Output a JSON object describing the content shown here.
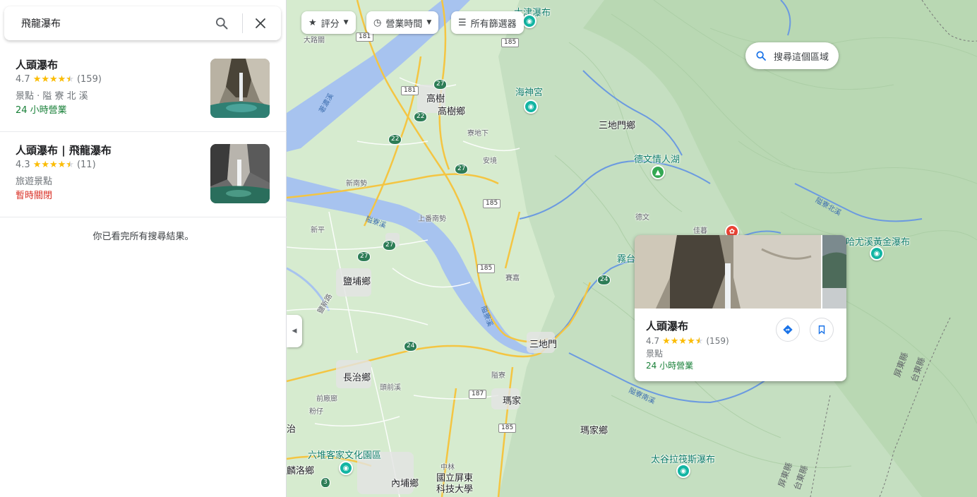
{
  "search": {
    "value": "飛龍瀑布"
  },
  "results": [
    {
      "title": "人頭瀑布",
      "rating": "4.7",
      "rating_value": 4.7,
      "reviews": "(159)",
      "category": "景點 · 隘 寮 北 溪",
      "status": "24 小時營業",
      "status_type": "open"
    },
    {
      "title": "人頭瀑布 | 飛龍瀑布",
      "rating": "4.3",
      "rating_value": 4.3,
      "reviews": "(11)",
      "category": "旅遊景點",
      "status": "暫時關閉",
      "status_type": "closed"
    }
  ],
  "end_text": "你已看完所有搜尋結果。",
  "filters": {
    "rating": "評分",
    "hours": "營業時間",
    "all": "所有篩選器"
  },
  "search_area": "搜尋這個區域",
  "map_labels": {
    "dajin_falls": "大津瀑布",
    "dajin_liao": "大路關",
    "gaoshu": "高樹",
    "gaoshu_xiang": "高樹鄉",
    "haishen_gong": "海神宮",
    "sandimen_xiang": "三地門鄉",
    "dewen_lake": "德文情人湖",
    "dewen": "德文",
    "jiachun": "佳暮",
    "wutai": "霧台",
    "hayouxi_falls": "哈尤溪黃金瀑布",
    "sandimen": "三地門",
    "yanpu": "鹽埔鄉",
    "changzhi": "長治鄉",
    "majia": "瑪家",
    "majia_xiang": "瑪家鄉",
    "liudui": "六堆客家文化園區",
    "taigula_falls": "太谷拉筏斯瀑布",
    "neipu": "內埔鄉",
    "pingtung_uni": "國立屏東\n科技大學",
    "linluo": "麟洛鄉",
    "zhi": "治",
    "xinnan": "新南勢",
    "shangdong": "上番南勢",
    "xinping": "新平",
    "saijia": "賽嘉",
    "anxi": "安境",
    "gaoshu_xia": "寮地下",
    "weiliao": "隘寮",
    "shekou": "頭前溪",
    "qianjia": "前廠廍",
    "fenzai": "粉仔",
    "zhonglin": "中林",
    "beiyan_river": "隘寮北溪",
    "weiliao_river": "隘寮溪",
    "weiliao_river2": "隘寮溪",
    "weiliao_nan": "隘寮南溪",
    "pingtung_county": "屏東縣",
    "taidong_county": "台東縣",
    "pingtung_county2": "屏東縣",
    "taidong_county2": "台東縣",
    "gaoping_river": "荖濃溪",
    "yanxin_road": "鹽新路"
  },
  "road_shields": {
    "r181a": "181",
    "r181b": "181",
    "r185a": "185",
    "r185b": "185",
    "r185c": "185",
    "r185d": "185",
    "r187": "187",
    "r27a": "27",
    "r27b": "27",
    "r27c": "27",
    "r27d": "27",
    "r22a": "22",
    "r22b": "22",
    "r24a": "24",
    "r24b": "24",
    "r3": "3"
  },
  "card": {
    "title": "人頭瀑布",
    "rating": "4.7",
    "rating_value": 4.7,
    "reviews": "(159)",
    "category": "景點",
    "status": "24 小時營業"
  },
  "colors": {
    "open": "#188038",
    "closed": "#d93025",
    "star": "#fbbc04",
    "accent": "#1a73e8"
  }
}
